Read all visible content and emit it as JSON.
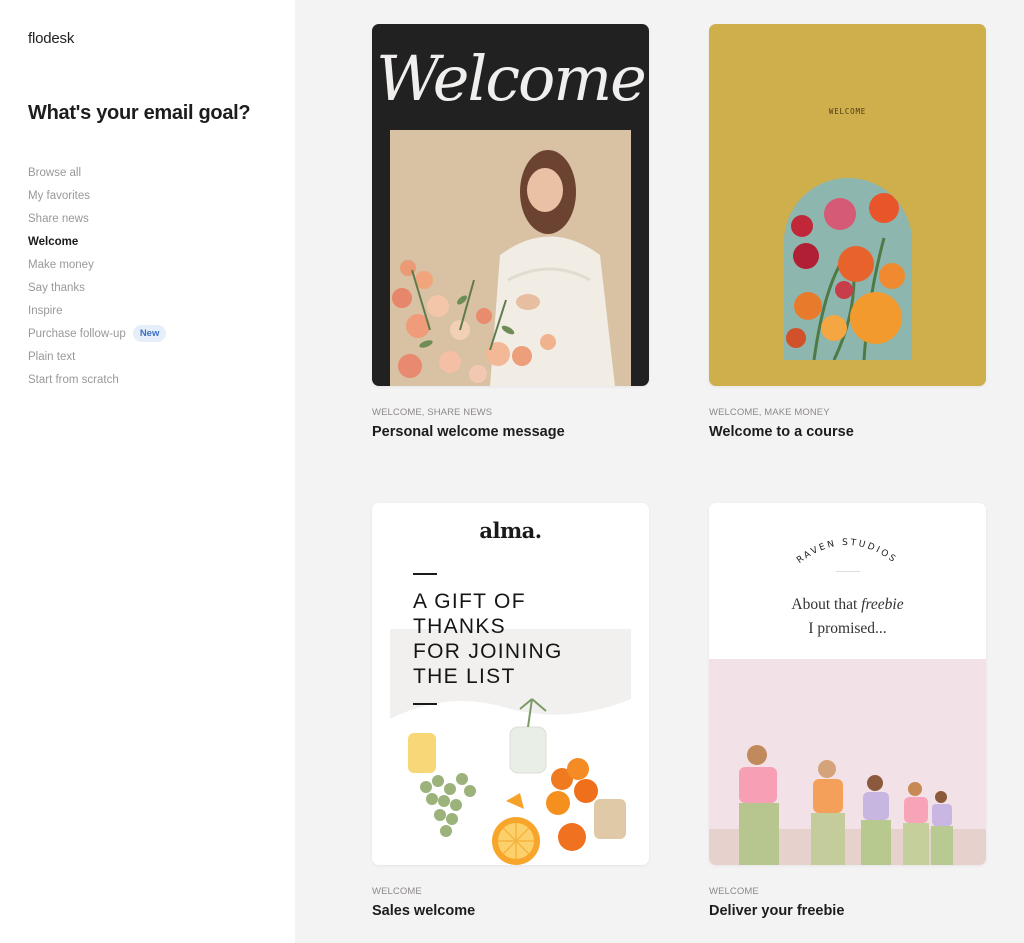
{
  "app": {
    "logo": "flodesk"
  },
  "sidebar": {
    "title": "What's your email goal?",
    "items": [
      {
        "label": "Browse all"
      },
      {
        "label": "My favorites"
      },
      {
        "label": "Share news"
      },
      {
        "label": "Welcome",
        "active": true
      },
      {
        "label": "Make money"
      },
      {
        "label": "Say thanks"
      },
      {
        "label": "Inspire"
      },
      {
        "label": "Purchase follow-up",
        "badge": "New"
      },
      {
        "label": "Plain text"
      },
      {
        "label": "Start from scratch"
      }
    ]
  },
  "templates": [
    {
      "tags": "WELCOME, SHARE NEWS",
      "title": "Personal welcome message",
      "preview": {
        "script_heading": "Welcome"
      }
    },
    {
      "tags": "WELCOME, MAKE MONEY",
      "title": "Welcome to a course",
      "preview": {
        "small_heading": "WELCOME"
      }
    },
    {
      "tags": "WELCOME",
      "title": "Sales welcome",
      "preview": {
        "brand": "alma.",
        "headline_lines": [
          "A GIFT OF",
          "THANKS",
          "FOR JOINING",
          "THE LIST"
        ]
      }
    },
    {
      "tags": "WELCOME",
      "title": "Deliver your freebie",
      "preview": {
        "studio": "RAVEN STUDIOS",
        "line1_prefix": "About that ",
        "line1_emph": "freebie",
        "line2": "I promised..."
      }
    }
  ],
  "colors": {
    "sidebar_bg": "#ffffff",
    "content_bg": "#f4f3f3",
    "card1_bg": "#222121",
    "card2_bg": "#cfae4c",
    "badge_text": "#3d6fbf",
    "badge_bg": "#e6eef9"
  }
}
